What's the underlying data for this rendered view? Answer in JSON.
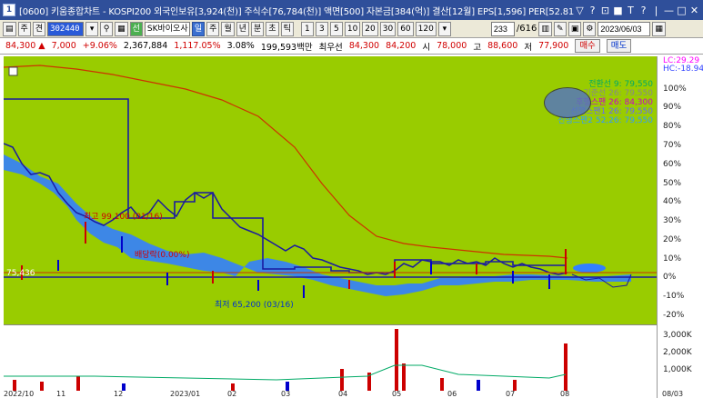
{
  "window": {
    "title": "[0600] 키움종합차트 - KOSPI200 외국인보유[3,924(천)] 주식수[76,784(천)] 액면[500] 자본금[384(억)] 결산[12월] EPS[1,596] PER[52.81] 시",
    "icon": "1",
    "controls": [
      "▽",
      "?",
      "⊡",
      "■",
      "T",
      "?",
      "|",
      "—",
      "□",
      "✕"
    ]
  },
  "toolbar": {
    "btn_main": "주",
    "btn_prefix": "견",
    "stock_code": "302440",
    "btn_search_icon": "search-icon",
    "btn_green": "선",
    "stock_name": "SK바이오사",
    "periods": [
      "일",
      "주",
      "월",
      "년",
      "분",
      "초",
      "틱"
    ],
    "active_period": "일",
    "intervals": [
      "1",
      "3",
      "5",
      "10",
      "20",
      "30",
      "60",
      "120"
    ],
    "count_value": "233",
    "count_total": "/616",
    "date_value": "2023/06/03"
  },
  "pricebar": {
    "price": "84,300",
    "change": "7,000",
    "change_pct": "+9.06%",
    "volume": "2,367,884",
    "vol_pct": "1,117.05%",
    "turnover": "3.08%",
    "amount": "199,593백만",
    "best_bid_label": "최우선",
    "bid": "84,300",
    "ask": "84,200",
    "open_label": "시",
    "open": "78,000",
    "high_label": "고",
    "high": "88,600",
    "low_label": "저",
    "low": "77,900",
    "buy_label": "매수",
    "sell_label": "매도"
  },
  "chart": {
    "lc_label": "LC:29.29",
    "hc_label": "HC:-18.94",
    "pct_ticks": [
      "100%",
      "90%",
      "80%",
      "70%",
      "60%",
      "50%",
      "40%",
      "30%",
      "20%",
      "10%",
      "0%",
      "-10%",
      "-20%"
    ],
    "volume_ticks": [
      "3,000K",
      "2,000K",
      "1,000K"
    ],
    "legend": [
      {
        "text": "전환선 9: 79,550",
        "color": "#00aa66"
      },
      {
        "text": "기준선 26: 79,550",
        "color": "#888888"
      },
      {
        "text": "후행스팬 26: 84,300",
        "color": "#cc00cc"
      },
      {
        "text": "선행스팬1 26: 79,550",
        "color": "#6666ff"
      },
      {
        "text": "선행스팬2 52,26: 79,550",
        "color": "#3399ff"
      }
    ],
    "annotations": {
      "high": "최고 99,100 (01/16)",
      "mid": "배당락(0.00%)",
      "low": "최저 65,200 (03/16)",
      "base_value": "75,436"
    },
    "date_labels": [
      "2022/10",
      "11",
      "12",
      "2023/01",
      "02",
      "03",
      "04",
      "05",
      "06",
      "07",
      "08",
      "08/03"
    ],
    "colors": {
      "plot_bg": "#99cc00",
      "cloud": "#3380ff",
      "line_red": "#cc3300",
      "line_navy": "#1a1aa0"
    }
  }
}
